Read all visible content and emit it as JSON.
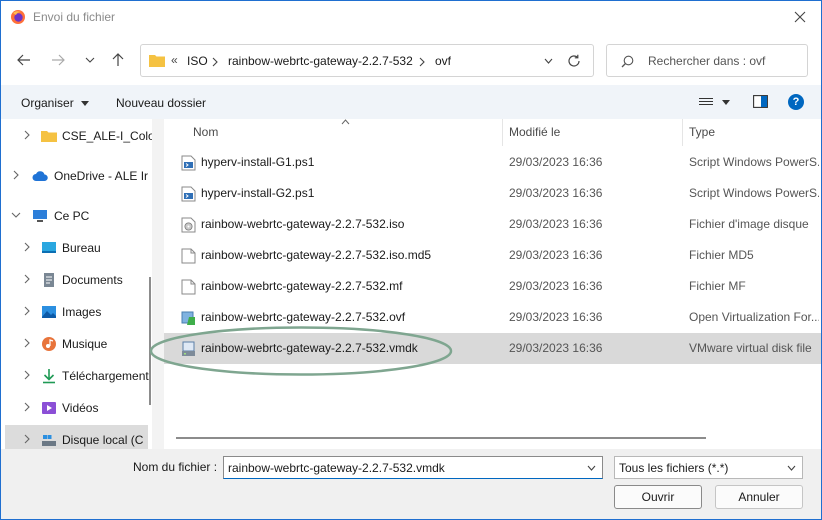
{
  "window": {
    "title": "Envoi du fichier"
  },
  "address": {
    "overflow": "«",
    "segments": [
      "ISO",
      "rainbow-webrtc-gateway-2.2.7-532",
      "ovf"
    ]
  },
  "search": {
    "placeholder": "Rechercher dans : ovf"
  },
  "toolbar": {
    "organize": "Organiser",
    "new_folder": "Nouveau dossier",
    "help": "?"
  },
  "sidebar": {
    "items": [
      {
        "label": "CSE_ALE-I_Colo",
        "icon": "folder-icon"
      },
      {
        "label": "OneDrive - ALE Ir",
        "icon": "cloud-icon"
      },
      {
        "label": "Ce PC",
        "icon": "computer-icon"
      },
      {
        "label": "Bureau",
        "icon": "desktop-icon"
      },
      {
        "label": "Documents",
        "icon": "document-icon"
      },
      {
        "label": "Images",
        "icon": "image-icon"
      },
      {
        "label": "Musique",
        "icon": "music-icon"
      },
      {
        "label": "Téléchargement",
        "icon": "download-icon"
      },
      {
        "label": "Vidéos",
        "icon": "video-icon"
      },
      {
        "label": "Disque local (C",
        "icon": "disk-icon"
      }
    ]
  },
  "columns": {
    "name": "Nom",
    "modified": "Modifié le",
    "type": "Type"
  },
  "files": [
    {
      "name": "hyperv-install-G1.ps1",
      "date": "29/03/2023 16:36",
      "type": "Script Windows PowerS...",
      "icon": "script-icon"
    },
    {
      "name": "hyperv-install-G2.ps1",
      "date": "29/03/2023 16:36",
      "type": "Script Windows PowerS...",
      "icon": "script-icon"
    },
    {
      "name": "rainbow-webrtc-gateway-2.2.7-532.iso",
      "date": "29/03/2023 16:36",
      "type": "Fichier d'image disque",
      "icon": "disc-image-icon"
    },
    {
      "name": "rainbow-webrtc-gateway-2.2.7-532.iso.md5",
      "date": "29/03/2023 16:36",
      "type": "Fichier MD5",
      "icon": "file-icon"
    },
    {
      "name": "rainbow-webrtc-gateway-2.2.7-532.mf",
      "date": "29/03/2023 16:36",
      "type": "Fichier MF",
      "icon": "file-icon"
    },
    {
      "name": "rainbow-webrtc-gateway-2.2.7-532.ovf",
      "date": "29/03/2023 16:36",
      "type": "Open Virtualization For...",
      "icon": "ovf-icon"
    },
    {
      "name": "rainbow-webrtc-gateway-2.2.7-532.vmdk",
      "date": "29/03/2023 16:36",
      "type": "VMware virtual disk file",
      "icon": "vmdk-icon"
    }
  ],
  "bottom": {
    "filename_label": "Nom du fichier :",
    "filename_value": "rainbow-webrtc-gateway-2.2.7-532.vmdk",
    "filetype": "Tous les fichiers (*.*)",
    "open": "Ouvrir",
    "cancel": "Annuler"
  },
  "colors": {
    "accent": "#0067c0",
    "selection": "#d9d9d9",
    "highlight_oval": "#7fa690",
    "folder": "#f5c242"
  }
}
